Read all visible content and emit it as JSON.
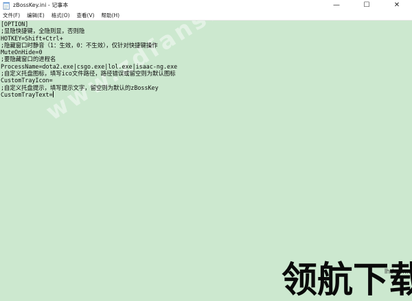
{
  "window": {
    "title": "zBossKey.ini - 记事本",
    "controls": {
      "minimize": "—",
      "maximize": "☐",
      "close": "✕"
    }
  },
  "menu": {
    "items": [
      "文件(F)",
      "编辑(E)",
      "格式(O)",
      "查看(V)",
      "帮助(H)"
    ]
  },
  "editor": {
    "lines": [
      "[OPTION]",
      ";显隐快捷键，全隐则显，否则隐",
      "HOTKEY=Shift+Ctrl+",
      ";隐藏窗口时静音（1：生效，0：不生效），仅针对快捷键操作",
      "MuteOnHide=0",
      ";要隐藏窗口的进程名",
      "ProcessName=dota2.exe|csgo.exe|lol.exe|isaac-ng.exe",
      ";自定义托盘图标，填写ico文件路径，路径错误或留空则为默认图标",
      "CustomTrayIcon=",
      ";自定义托盘提示，填写提示文字，留空则为默认的zBossKey",
      "CustomTrayText="
    ],
    "background": "#cce8cf"
  },
  "watermark": {
    "text": "www.zdfans.com"
  },
  "branding": {
    "url": "lhdown.com",
    "name": "领航下载"
  }
}
